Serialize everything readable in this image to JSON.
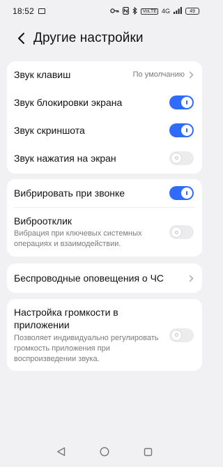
{
  "status_bar": {
    "time": "18:52",
    "network_4g": "4G",
    "volte": "VoLTE",
    "battery": "49"
  },
  "header": {
    "title": "Другие настройки",
    "back_icon": "chevron-left-icon"
  },
  "group1": [
    {
      "title": "Звук клавиш",
      "value": "По умолчанию",
      "type": "link"
    },
    {
      "title": "Звук блокировки экрана",
      "type": "toggle",
      "on": true
    },
    {
      "title": "Звук скриншота",
      "type": "toggle",
      "on": true
    },
    {
      "title": "Звук нажатия на экран",
      "type": "toggle",
      "on": false
    }
  ],
  "group2": [
    {
      "title": "Вибрировать при звонке",
      "type": "toggle",
      "on": true
    },
    {
      "title": "Виброотклик",
      "subtitle": "Вибрация при ключевых системных операциях и взаимодействии.",
      "type": "toggle",
      "on": false
    }
  ],
  "group3": [
    {
      "title": "Беспроводные оповещения о ЧС",
      "type": "link"
    }
  ],
  "group4": [
    {
      "title": "Настройка громкости в приложении",
      "subtitle": "Позволяет индивидуально регулировать громкость приложения при воспроизведении звука.",
      "type": "toggle",
      "on": false
    }
  ],
  "colors": {
    "accent": "#2f6bff",
    "background": "#f1f1f4",
    "card": "#ffffff",
    "secondary_text": "#7a7a7a"
  }
}
